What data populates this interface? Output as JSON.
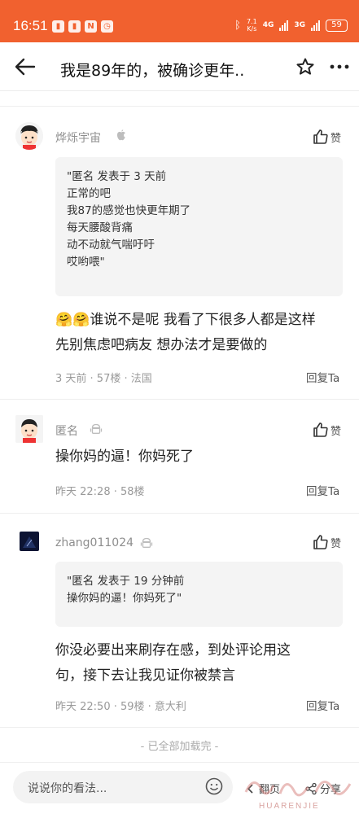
{
  "status_bar": {
    "time": "16:51",
    "net_speed_value": "7.1",
    "net_speed_unit": "K/s",
    "network_1": "4G",
    "network_2": "3G",
    "battery": "59"
  },
  "header": {
    "title": "我是89年的，被确诊更年.."
  },
  "comments": [
    {
      "username": "烨烁宇宙",
      "like_label": "赞",
      "quote_lines": [
        "\"匿名 发表于 3 天前",
        "正常的吧",
        "我87的感觉也快更年期了",
        "每天腰酸背痛",
        "动不动就气喘吁吁",
        "哎哟喂\""
      ],
      "body_line1": "🤗🤗谁说不是呢  我看了下很多人都是这样",
      "body_line2": "先别焦虑吧病友  想办法才是要做的",
      "meta": "3 天前 · 57楼 · 法国",
      "reply": "回复Ta"
    },
    {
      "username": "匿名",
      "like_label": "赞",
      "body_line1": "操你妈的逼！你妈死了",
      "meta": "昨天 22:28 · 58楼",
      "reply": "回复Ta"
    },
    {
      "username": "zhang011024",
      "like_label": "赞",
      "quote_lines": [
        "\"匿名 发表于 19 分钟前",
        "操你妈的逼！你妈死了\""
      ],
      "body_line1": "你没必要出来刷存在感，到处评论用这",
      "body_line2": "句，接下去让我见证你被禁言",
      "meta": "昨天 22:50 · 59楼 · 意大利",
      "reply": "回复Ta"
    }
  ],
  "footer": {
    "loaded_text": "- 已全部加载完 -"
  },
  "bottom_bar": {
    "input_placeholder": "说说你的看法...",
    "flip_label": "翻页",
    "share_label": "分享",
    "watermark_text": "HUARENJIE"
  },
  "colors": {
    "accent": "#f1612f"
  }
}
